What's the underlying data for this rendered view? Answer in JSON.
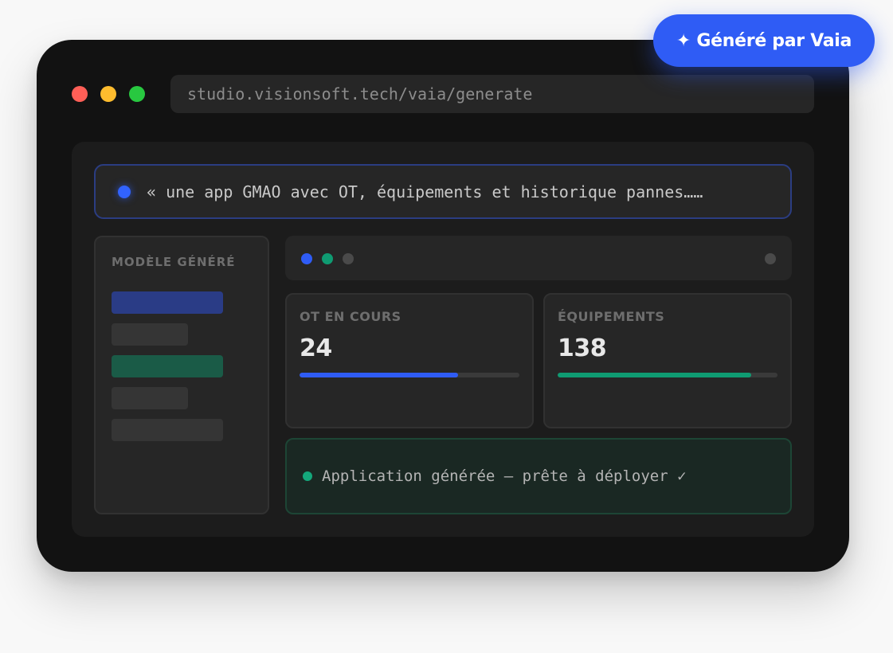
{
  "badge": {
    "icon": "sparkle-icon",
    "label": "✦ Généré par Vaia"
  },
  "window": {
    "url": "studio.visionsoft.tech/vaia/generate",
    "traffic_lights": [
      "#ff5f57",
      "#febc2e",
      "#28c840"
    ]
  },
  "prompt": {
    "text": "« une app GMAO avec OT, équipements et historique pannes……"
  },
  "sidebar": {
    "title": "MODÈLE GÉNÉRÉ"
  },
  "cards": [
    {
      "label": "OT EN COURS",
      "value": "24",
      "progress": 0.72,
      "color": "#2f5cf5"
    },
    {
      "label": "ÉQUIPEMENTS",
      "value": "138",
      "progress": 0.88,
      "color": "#0f9b72"
    }
  ],
  "status": {
    "text": "Application générée — prête à déployer ✓"
  },
  "colors": {
    "accent": "#2f5cf5",
    "success": "#0f9b72",
    "background": "#121212"
  }
}
